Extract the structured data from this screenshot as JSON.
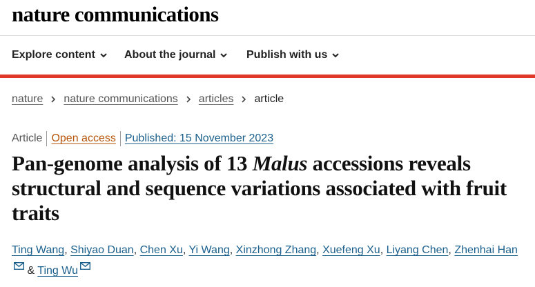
{
  "site": {
    "logo": "nature communications"
  },
  "nav": {
    "items": [
      {
        "label": "Explore content"
      },
      {
        "label": "About the journal"
      },
      {
        "label": "Publish with us"
      }
    ]
  },
  "breadcrumb": {
    "items": [
      {
        "label": "nature"
      },
      {
        "label": "nature communications"
      },
      {
        "label": "articles"
      },
      {
        "label": "article"
      }
    ]
  },
  "article": {
    "type": "Article",
    "access": "Open access",
    "published": "Published: 15 November 2023",
    "title_before": "Pan-genome analysis of 13 ",
    "title_italic": "Malus",
    "title_after": " accessions reveals structural and sequence variations associated with fruit traits",
    "authors": [
      "Ting Wang",
      "Shiyao Duan",
      "Chen Xu",
      "Yi Wang",
      "Xinzhong Zhang",
      "Xuefeng Xu",
      "Liyang Chen",
      "Zhenhai Han",
      "Ting Wu"
    ],
    "author_separator": ", ",
    "author_conjunction": " & "
  },
  "colors": {
    "accent": "#e0392a",
    "link": "#1a5f8c",
    "open_access": "#b7550a"
  },
  "icons": {
    "nav_chevron": "chevron-down-icon",
    "breadcrumb_separator": "chevron-right-icon",
    "corresponding_author": "mail-icon"
  }
}
